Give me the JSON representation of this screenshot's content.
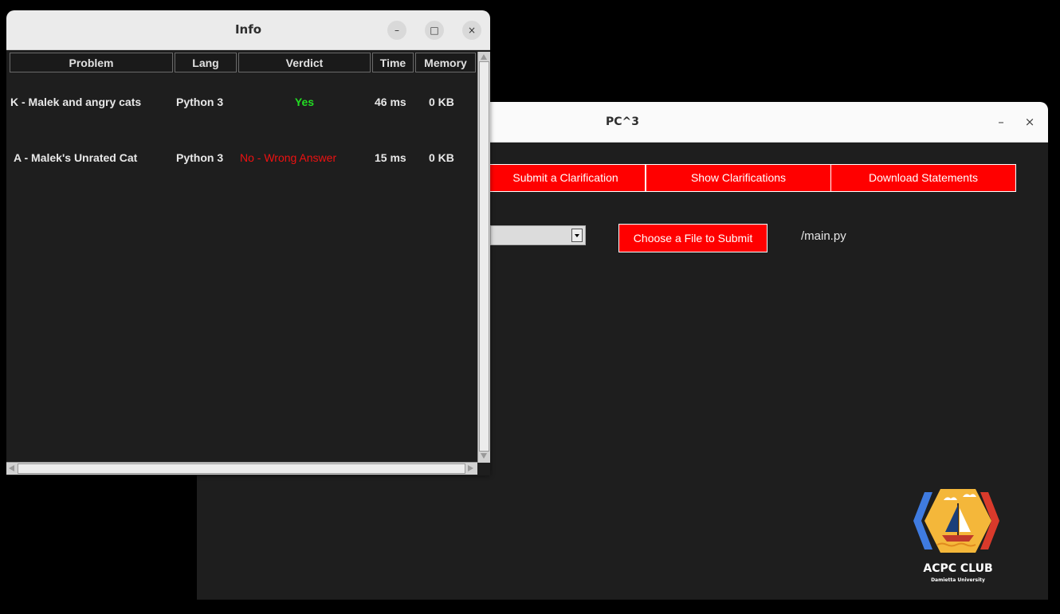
{
  "pc3_window": {
    "title": "PC^3",
    "minimize": "–",
    "close": "×",
    "buttons": {
      "submit_clarification": "Submit a Clarification",
      "show_clarifications": "Show Clarifications",
      "download_statements": "Download Statements",
      "choose_file": "Choose a File to Submit"
    },
    "selected_file": "/main.py",
    "logo": {
      "title": "ACPC CLUB",
      "subtitle": "Damietta University"
    }
  },
  "info_window": {
    "title": "Info",
    "minimize": "–",
    "maximize": "□",
    "close": "×",
    "columns": [
      "Problem",
      "Lang",
      "Verdict",
      "Time",
      "Memory"
    ],
    "rows": [
      {
        "problem": "K - Malek and angry cats",
        "lang": "Python 3",
        "verdict": "Yes",
        "time": "46 ms",
        "memory": "0 KB"
      },
      {
        "problem": "A - Malek's Unrated Cat",
        "lang": "Python 3",
        "verdict": "No - Wrong Answer",
        "time": "15 ms",
        "memory": "0 KB"
      }
    ]
  },
  "colors": {
    "accent": "#ff0000",
    "verdict_yes": "#22dd22",
    "verdict_no": "#ee1111",
    "background": "#1e1e1e"
  }
}
